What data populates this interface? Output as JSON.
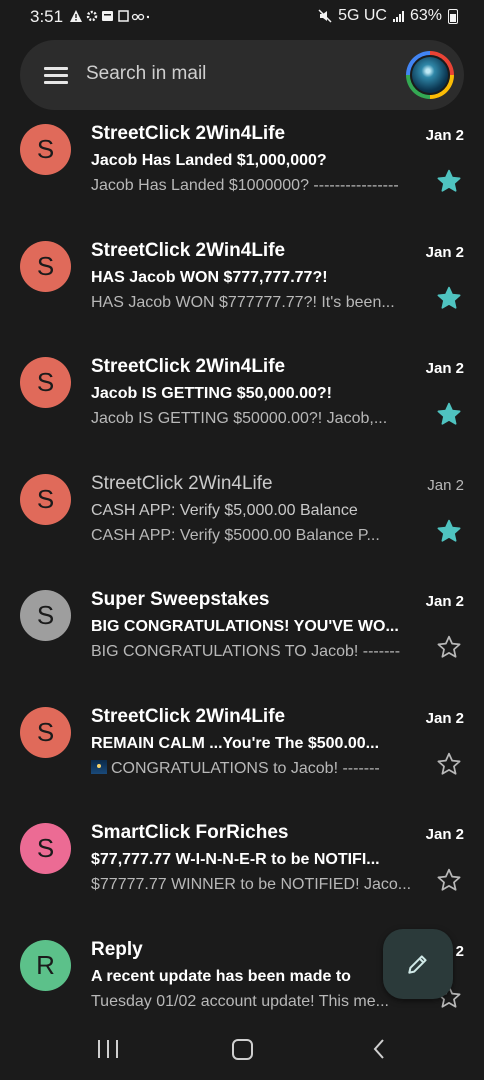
{
  "status_bar": {
    "time": "3:51",
    "left_icons": [
      "warning-icon",
      "gear-icon",
      "sim-icon",
      "screen-icon",
      "voicemail-icon",
      "dot-icon"
    ],
    "network": "5G UC",
    "battery": "63%"
  },
  "search": {
    "placeholder": "Search in mail"
  },
  "emails": [
    {
      "avatar_letter": "S",
      "avatar_color": "#e06a5a",
      "sender": "StreetClick 2Win4Life",
      "date": "Jan 2",
      "subject": "Jacob Has Landed $1,000,000?",
      "snippet": "Jacob Has Landed $1000000? ----------------",
      "starred": true,
      "unread": true
    },
    {
      "avatar_letter": "S",
      "avatar_color": "#e06a5a",
      "sender": "StreetClick 2Win4Life",
      "date": "Jan 2",
      "subject": "HAS Jacob WON $777,777.77?!",
      "snippet": "HAS Jacob WON $777777.77?! It's been...",
      "starred": true,
      "unread": true
    },
    {
      "avatar_letter": "S",
      "avatar_color": "#e06a5a",
      "sender": "StreetClick 2Win4Life",
      "date": "Jan 2",
      "subject": "Jacob IS GETTING $50,000.00?!",
      "snippet": "Jacob IS GETTING $50000.00?! Jacob,...",
      "starred": true,
      "unread": true
    },
    {
      "avatar_letter": "S",
      "avatar_color": "#e06a5a",
      "sender": "StreetClick 2Win4Life",
      "date": "Jan 2",
      "subject": "CASH APP: Verify $5,000.00 Balance",
      "snippet": "CASH APP: Verify $5000.00 Balance P...",
      "starred": true,
      "unread": false
    },
    {
      "avatar_letter": "S",
      "avatar_color": "#9e9e9e",
      "sender": "Super Sweepstakes",
      "date": "Jan 2",
      "subject": "BIG CONGRATULATIONS! YOU'VE WO...",
      "snippet": "BIG CONGRATULATIONS TO Jacob! -------",
      "starred": false,
      "unread": true
    },
    {
      "avatar_letter": "S",
      "avatar_color": "#e06a5a",
      "sender": "StreetClick 2Win4Life",
      "date": "Jan 2",
      "subject": "REMAIN CALM ...You're The $500.00...",
      "snippet": "CONGRATULATIONS to Jacob! -------",
      "snippet_icon": "night-sky-emoji-icon",
      "starred": false,
      "unread": true
    },
    {
      "avatar_letter": "S",
      "avatar_color": "#ec6b94",
      "sender": "SmartClick ForRiches",
      "date": "Jan 2",
      "subject": "$77,777.77 W-I-N-N-E-R to be NOTIFI...",
      "snippet": "$77777.77 WINNER to be NOTIFIED! Jaco...",
      "starred": false,
      "unread": true
    },
    {
      "avatar_letter": "R",
      "avatar_color": "#5cc18a",
      "sender": "Reply",
      "date": "Jan 2",
      "subject": "A recent update has been made to",
      "snippet": "Tuesday 01/02 account update! This me...",
      "starred": false,
      "unread": true
    }
  ],
  "colors": {
    "background": "#1b1b1b",
    "star_filled": "#4fc3c0",
    "star_outline": "#b8b8b8",
    "fab": "#2b3a3a"
  },
  "fab": {
    "icon": "pencil-icon"
  },
  "nav_bar": {
    "items": [
      "recents-icon",
      "home-icon",
      "back-icon"
    ]
  }
}
